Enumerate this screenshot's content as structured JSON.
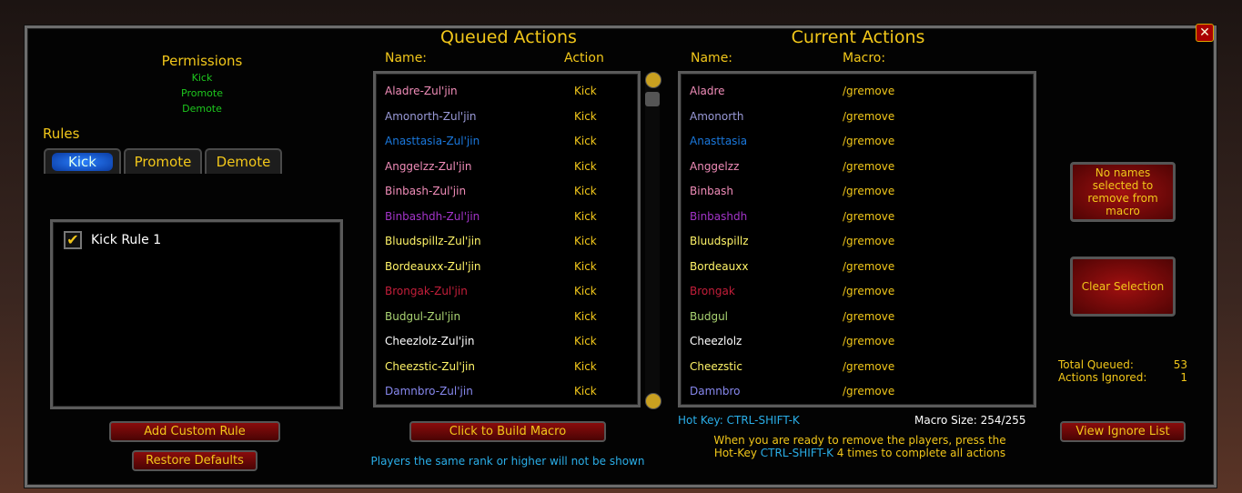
{
  "colors": {
    "gold": "#f2c71a",
    "green": "#1ec81e",
    "cyan": "#2aaee8",
    "button_red": "#8a0c0c"
  },
  "permissions": {
    "title": "Permissions",
    "items": [
      "Kick",
      "Promote",
      "Demote"
    ]
  },
  "rules": {
    "title": "Rules",
    "tabs": [
      "Kick",
      "Promote",
      "Demote"
    ],
    "active_tab": "Kick",
    "items": [
      {
        "label": "Kick Rule 1",
        "checked": true
      }
    ],
    "add_button": "Add Custom Rule",
    "restore_button": "Restore Defaults"
  },
  "queued": {
    "title": "Queued Actions",
    "col_name": "Name:",
    "col_action": "Action",
    "build_button": "Click to Build Macro",
    "note": "Players the same rank or higher will not be shown",
    "rows": [
      {
        "name": "Aladre-Zul'jin",
        "action": "Kick",
        "color": "#f08cb8"
      },
      {
        "name": "Amonorth-Zul'jin",
        "action": "Kick",
        "color": "#9a9ad8"
      },
      {
        "name": "Anasttasia-Zul'jin",
        "action": "Kick",
        "color": "#1a78dd"
      },
      {
        "name": "Anggelzz-Zul'jin",
        "action": "Kick",
        "color": "#f08cb8"
      },
      {
        "name": "Binbash-Zul'jin",
        "action": "Kick",
        "color": "#f08cb8"
      },
      {
        "name": "Binbashdh-Zul'jin",
        "action": "Kick",
        "color": "#a334c9"
      },
      {
        "name": "Bluudspillz-Zul'jin",
        "action": "Kick",
        "color": "#fff468"
      },
      {
        "name": "Bordeauxx-Zul'jin",
        "action": "Kick",
        "color": "#fff468"
      },
      {
        "name": "Brongak-Zul'jin",
        "action": "Kick",
        "color": "#c41e3a"
      },
      {
        "name": "Budgul-Zul'jin",
        "action": "Kick",
        "color": "#aad372"
      },
      {
        "name": "Cheezlolz-Zul'jin",
        "action": "Kick",
        "color": "#ffffff"
      },
      {
        "name": "Cheezstic-Zul'jin",
        "action": "Kick",
        "color": "#fff468"
      },
      {
        "name": "Damnbro-Zul'jin",
        "action": "Kick",
        "color": "#8788ee"
      }
    ]
  },
  "current": {
    "title": "Current Actions",
    "col_name": "Name:",
    "col_macro": "Macro:",
    "rows": [
      {
        "name": "Aladre",
        "macro": "/gremove",
        "color": "#f08cb8"
      },
      {
        "name": "Amonorth",
        "macro": "/gremove",
        "color": "#9a9ad8"
      },
      {
        "name": "Anasttasia",
        "macro": "/gremove",
        "color": "#1a78dd"
      },
      {
        "name": "Anggelzz",
        "macro": "/gremove",
        "color": "#f08cb8"
      },
      {
        "name": "Binbash",
        "macro": "/gremove",
        "color": "#f08cb8"
      },
      {
        "name": "Binbashdh",
        "macro": "/gremove",
        "color": "#a334c9"
      },
      {
        "name": "Bluudspillz",
        "macro": "/gremove",
        "color": "#fff468"
      },
      {
        "name": "Bordeauxx",
        "macro": "/gremove",
        "color": "#fff468"
      },
      {
        "name": "Brongak",
        "macro": "/gremove",
        "color": "#c41e3a"
      },
      {
        "name": "Budgul",
        "macro": "/gremove",
        "color": "#aad372"
      },
      {
        "name": "Cheezlolz",
        "macro": "/gremove",
        "color": "#ffffff"
      },
      {
        "name": "Cheezstic",
        "macro": "/gremove",
        "color": "#fff468"
      },
      {
        "name": "Damnbro",
        "macro": "/gremove",
        "color": "#8788ee"
      }
    ],
    "hotkey_label": "Hot Key: CTRL-SHIFT-K",
    "macro_size": "Macro Size: 254/255",
    "instr_1": "When you are ready to remove the players, press the",
    "instr_2a": "Hot-Key",
    "instr_2b": "CTRL-SHIFT-K",
    "instr_2c": "4 times to complete all actions"
  },
  "side": {
    "remove_button": "No names selected to remove from macro",
    "clear_button": "Clear Selection",
    "total_label": "Total Queued:",
    "total_value": "53",
    "ignored_label": "Actions Ignored:",
    "ignored_value": "1",
    "ignore_button": "View Ignore List"
  },
  "close_icon": "close-x-icon"
}
